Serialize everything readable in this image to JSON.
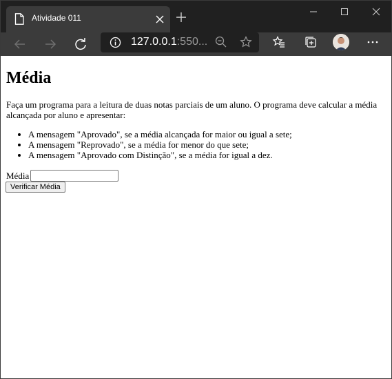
{
  "browser": {
    "tab_title": "Atividade 011",
    "url_host": "127.0.0.1",
    "url_rest": ":550...",
    "icons": [
      "page-icon",
      "close-icon",
      "plus-icon",
      "minimize-icon",
      "maximize-icon",
      "window-close-icon",
      "back-arrow-icon",
      "forward-arrow-icon",
      "refresh-icon",
      "info-icon",
      "zoom-out-icon",
      "star-icon",
      "favorites-list-icon",
      "collections-icon",
      "avatar",
      "more-icon"
    ]
  },
  "page": {
    "heading": "Média",
    "description": "Faça um programa para a leitura de duas notas parciais de um aluno. O programa deve calcular a média alcançada por aluno e apresentar:",
    "rules": [
      "A mensagem \"Aprovado\", se a média alcançada for maior ou igual a sete;",
      "A mensagem \"Reprovado\", se a média for menor do que sete;",
      "A mensagem \"Aprovado com Distinção\", se a média for igual a dez."
    ],
    "form": {
      "label": "Média",
      "input_value": "",
      "button_label": "Verificar Média"
    }
  }
}
